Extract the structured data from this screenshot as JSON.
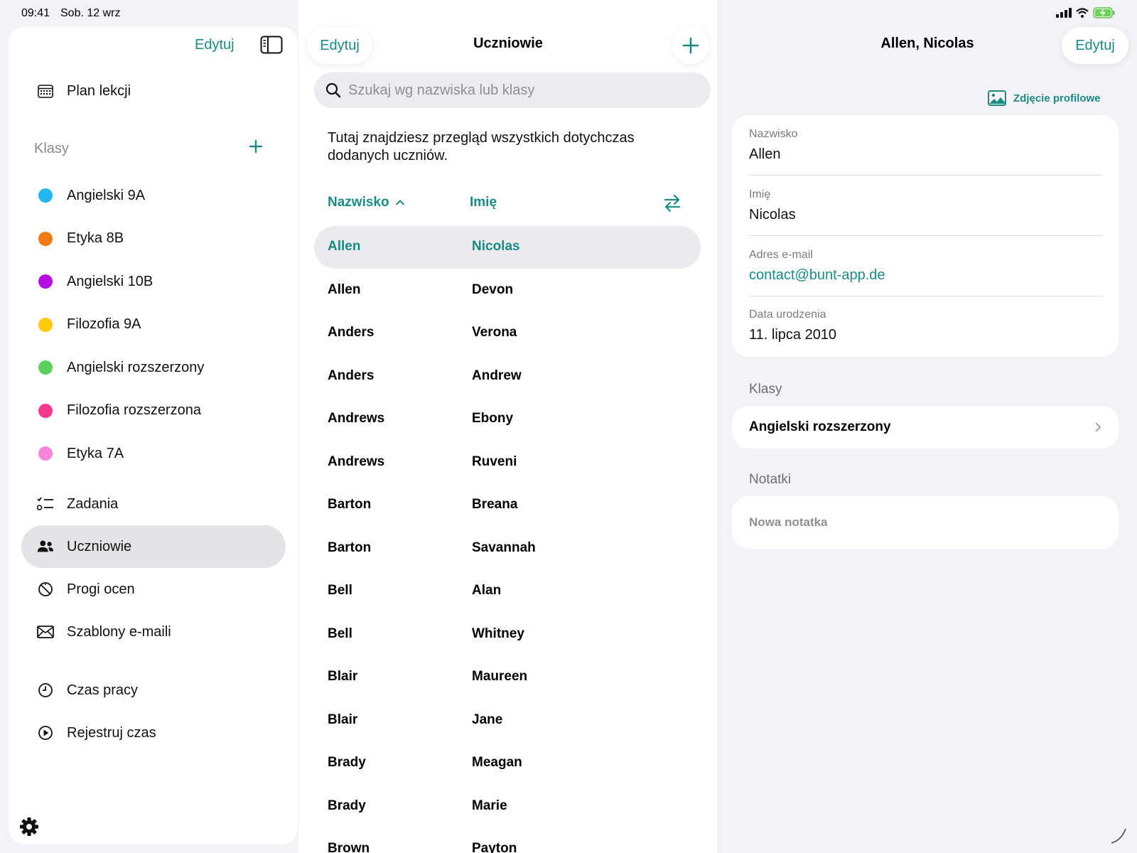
{
  "status_bar": {
    "time": "09:41",
    "date": "Sob. 12 wrz",
    "icons": [
      "signal-icon",
      "wifi-icon",
      "battery-charging-icon"
    ]
  },
  "colors": {
    "accent": "#1a8a85",
    "selection": "#e4e4e7"
  },
  "sidebar": {
    "edit_label": "Edytuj",
    "schedule_label": "Plan lekcji",
    "classes_section": "Klasy",
    "classes": [
      {
        "label": "Angielski 9A",
        "color": "#1fb8f0"
      },
      {
        "label": "Etyka 8B",
        "color": "#f27a14"
      },
      {
        "label": "Angielski 10B",
        "color": "#b20fe0"
      },
      {
        "label": "Filozofia 9A",
        "color": "#ffc90a"
      },
      {
        "label": "Angielski rozszerzony",
        "color": "#5cd05a"
      },
      {
        "label": "Filozofia rozszerzona",
        "color": "#f7388d"
      },
      {
        "label": "Etyka 7A",
        "color": "#f785d9"
      }
    ],
    "nav": [
      {
        "label": "Zadania",
        "icon": "checklist-icon"
      },
      {
        "label": "Uczniowie",
        "icon": "people-icon",
        "active": true
      },
      {
        "label": "Progi ocen",
        "icon": "grade-thresholds-icon"
      },
      {
        "label": "Szablony e-maili",
        "icon": "envelope-icon"
      },
      {
        "label": "Czas pracy",
        "icon": "clock-icon"
      },
      {
        "label": "Rejestruj czas",
        "icon": "play-circle-icon"
      }
    ]
  },
  "students": {
    "edit_label": "Edytuj",
    "title": "Uczniowie",
    "search_placeholder": "Szukaj wg nazwiska lub klasy",
    "intro": "Tutaj znajdziesz przegląd wszystkich dotychczas dodanych uczniów.",
    "col_lastname": "Nazwisko",
    "col_firstname": "Imię",
    "rows": [
      {
        "last": "Allen",
        "first": "Nicolas",
        "selected": true
      },
      {
        "last": "Allen",
        "first": "Devon"
      },
      {
        "last": "Anders",
        "first": "Verona"
      },
      {
        "last": "Anders",
        "first": "Andrew"
      },
      {
        "last": "Andrews",
        "first": "Ebony"
      },
      {
        "last": "Andrews",
        "first": "Ruveni"
      },
      {
        "last": "Barton",
        "first": "Breana"
      },
      {
        "last": "Barton",
        "first": "Savannah"
      },
      {
        "last": "Bell",
        "first": "Alan"
      },
      {
        "last": "Bell",
        "first": "Whitney"
      },
      {
        "last": "Blair",
        "first": "Maureen"
      },
      {
        "last": "Blair",
        "first": "Jane"
      },
      {
        "last": "Brady",
        "first": "Meagan"
      },
      {
        "last": "Brady",
        "first": "Marie"
      },
      {
        "last": "Brown",
        "first": "Payton"
      }
    ]
  },
  "detail": {
    "title": "Allen, Nicolas",
    "edit_label": "Edytuj",
    "photo_label": "Zdjęcie profilowe",
    "fields": [
      {
        "label": "Nazwisko",
        "value": "Allen"
      },
      {
        "label": "Imię",
        "value": "Nicolas"
      },
      {
        "label": "Adres e-mail",
        "value": "contact@bunt-app.de"
      },
      {
        "label": "Data urodzenia",
        "value": "11. lipca 2010"
      }
    ],
    "classes_section": "Klasy",
    "classes": [
      "Angielski rozszerzony"
    ],
    "notes_section": "Notatki",
    "new_note": "Nowa notatka"
  }
}
